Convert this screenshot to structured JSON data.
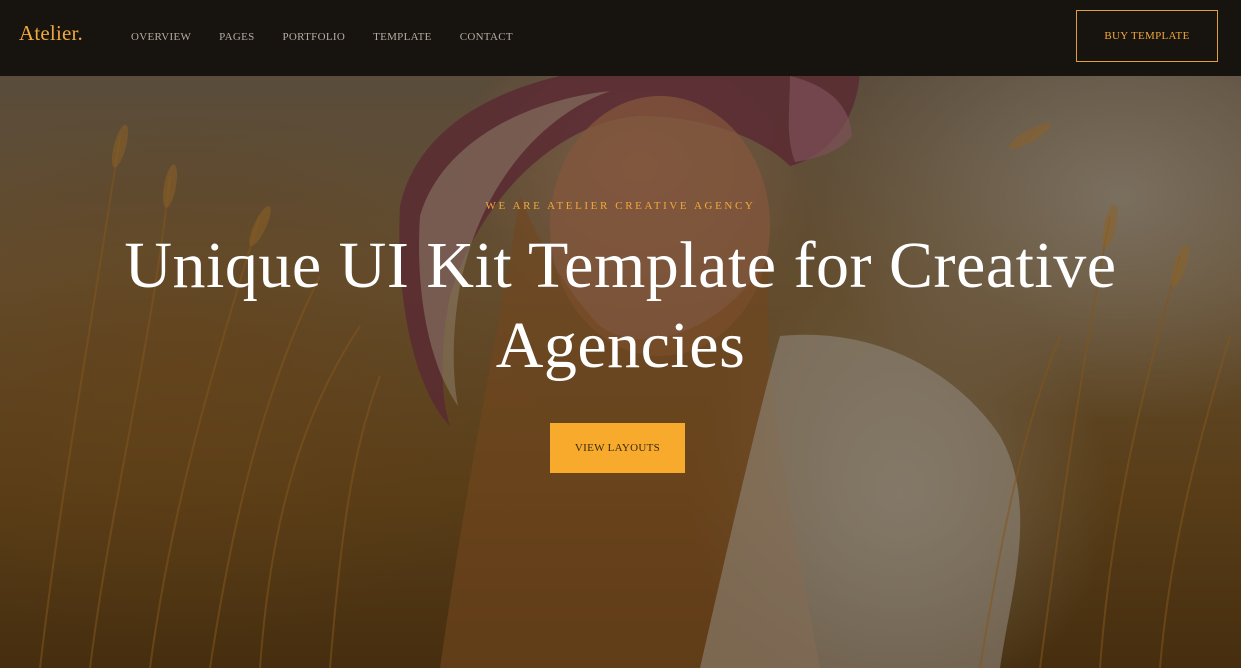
{
  "brand": {
    "name": "Atelier."
  },
  "nav": {
    "items": [
      {
        "label": "OVERVIEW"
      },
      {
        "label": "PAGES"
      },
      {
        "label": "PORTFOLIO"
      },
      {
        "label": "TEMPLATE"
      },
      {
        "label": "CONTACT"
      }
    ],
    "buy_label": "BUY TEMPLATE"
  },
  "hero": {
    "eyebrow": "WE ARE ATELIER CREATIVE AGENCY",
    "title": "Unique UI Kit Template for Creative Agencies",
    "cta_label": "VIEW LAYOUTS",
    "image": "woman-in-wheat-field-photo"
  },
  "colors": {
    "accent": "#f0a93a",
    "cta_background": "#f7aa2c",
    "navbar_background": "#17130f",
    "hero_title": "#ffffff"
  }
}
